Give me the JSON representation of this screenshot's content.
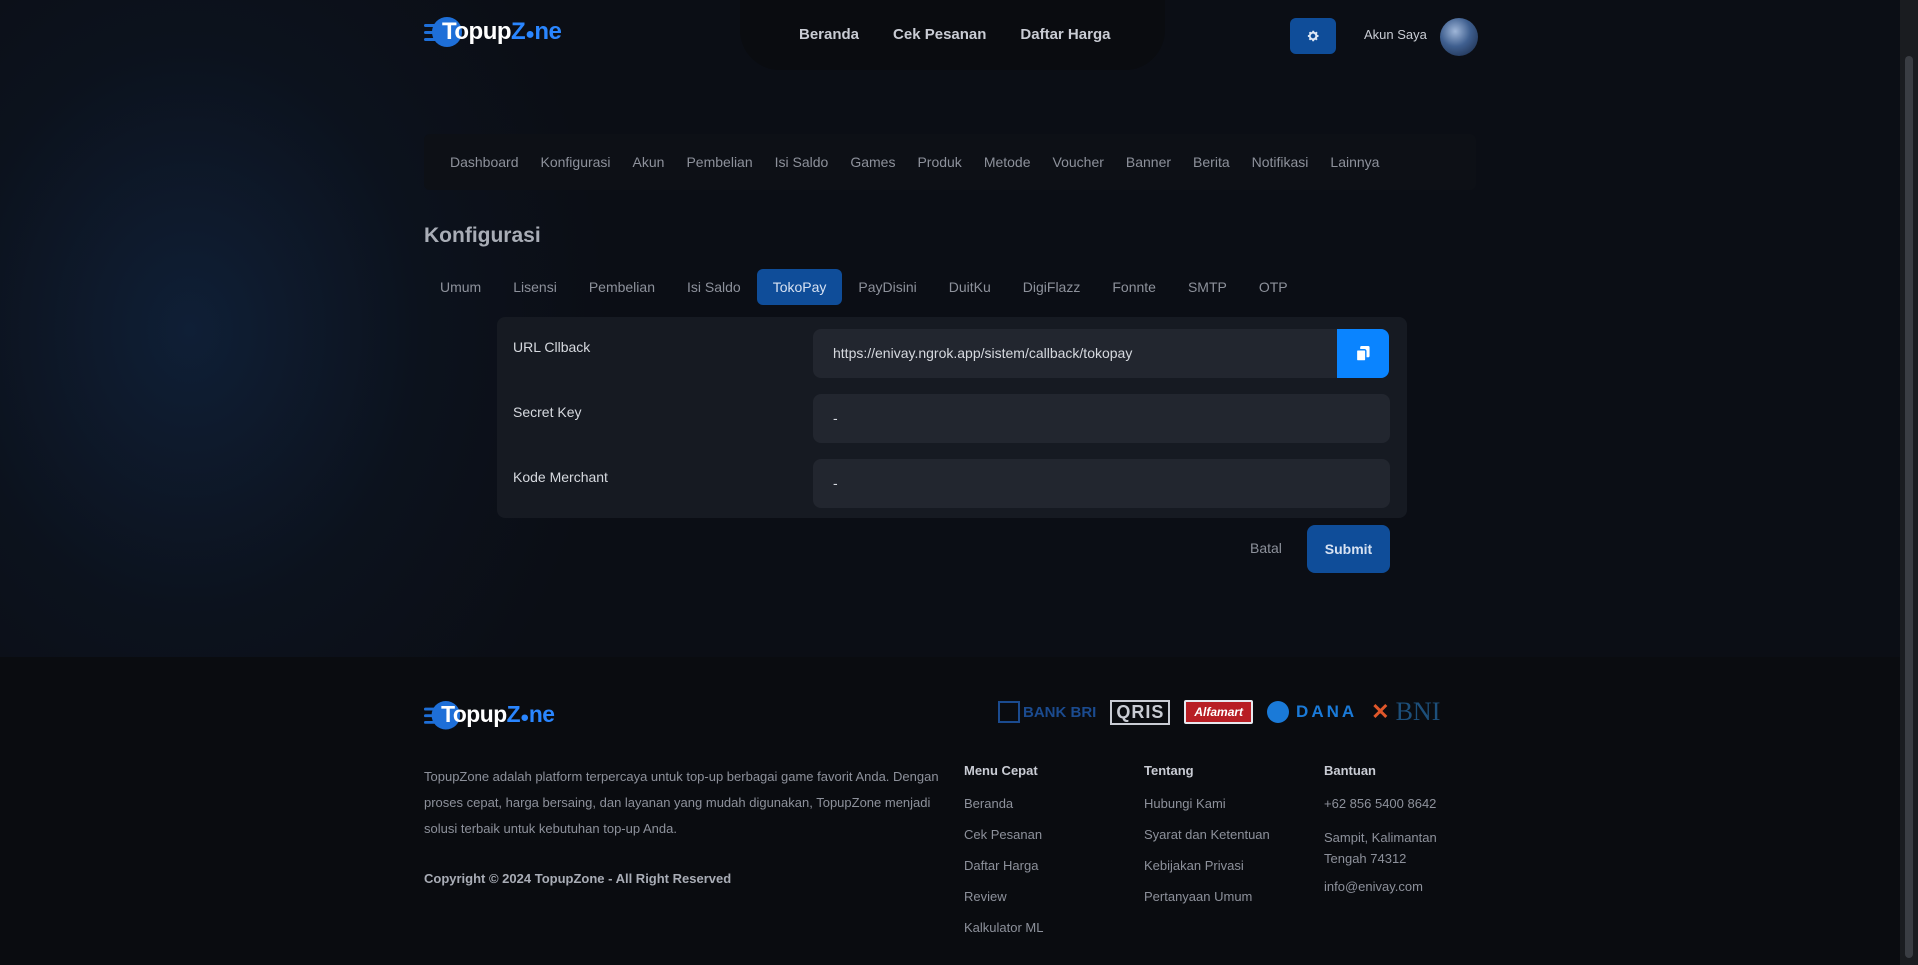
{
  "brand": {
    "name_part1": "Topup",
    "name_part2": "Z",
    "name_part3": "ne"
  },
  "topnav": {
    "items": [
      "Beranda",
      "Cek Pesanan",
      "Daftar Harga"
    ]
  },
  "account": {
    "label": "Akun Saya"
  },
  "admin_menu": {
    "items": [
      "Dashboard",
      "Konfigurasi",
      "Akun",
      "Pembelian",
      "Isi Saldo",
      "Games",
      "Produk",
      "Metode",
      "Voucher",
      "Banner",
      "Berita",
      "Notifikasi",
      "Lainnya"
    ]
  },
  "page": {
    "title": "Konfigurasi"
  },
  "tabs": {
    "items": [
      "Umum",
      "Lisensi",
      "Pembelian",
      "Isi Saldo",
      "TokoPay",
      "PayDisini",
      "DuitKu",
      "DigiFlazz",
      "Fonnte",
      "SMTP",
      "OTP"
    ],
    "active": "TokoPay"
  },
  "form": {
    "fields": [
      {
        "label": "URL Cllback",
        "value": "https://enivay.ngrok.app/sistem/callback/tokopay"
      },
      {
        "label": "Secret Key",
        "value": "-"
      },
      {
        "label": "Kode Merchant",
        "value": "-"
      }
    ],
    "cancel_label": "Batal",
    "submit_label": "Submit"
  },
  "footer": {
    "payment_logos": {
      "bri": "BANK BRI",
      "qris": "QRIS",
      "alfamart": "Alfamart",
      "dana": "DANA",
      "bni": "BNI"
    },
    "about": "TopupZone adalah platform terpercaya untuk top-up berbagai game favorit Anda. Dengan proses cepat, harga bersaing, dan layanan yang mudah digunakan, TopupZone menjadi solusi terbaik untuk kebutuhan top-up Anda.",
    "copyright": "Copyright © 2024 TopupZone - All Right Reserved",
    "menu_cepat": {
      "title": "Menu Cepat",
      "items": [
        "Beranda",
        "Cek Pesanan",
        "Daftar Harga",
        "Review",
        "Kalkulator ML"
      ]
    },
    "tentang": {
      "title": "Tentang",
      "items": [
        "Hubungi Kami",
        "Syarat dan Ketentuan",
        "Kebijakan Privasi",
        "Pertanyaan Umum"
      ]
    },
    "bantuan": {
      "title": "Bantuan",
      "items": [
        "+62 856 5400 8642",
        "Sampit, Kalimantan Tengah 74312",
        "info@enivay.com"
      ]
    }
  },
  "colors": {
    "accent": "#0f4d99",
    "copy_button": "#0a84ff",
    "background": "#0b0e14"
  }
}
